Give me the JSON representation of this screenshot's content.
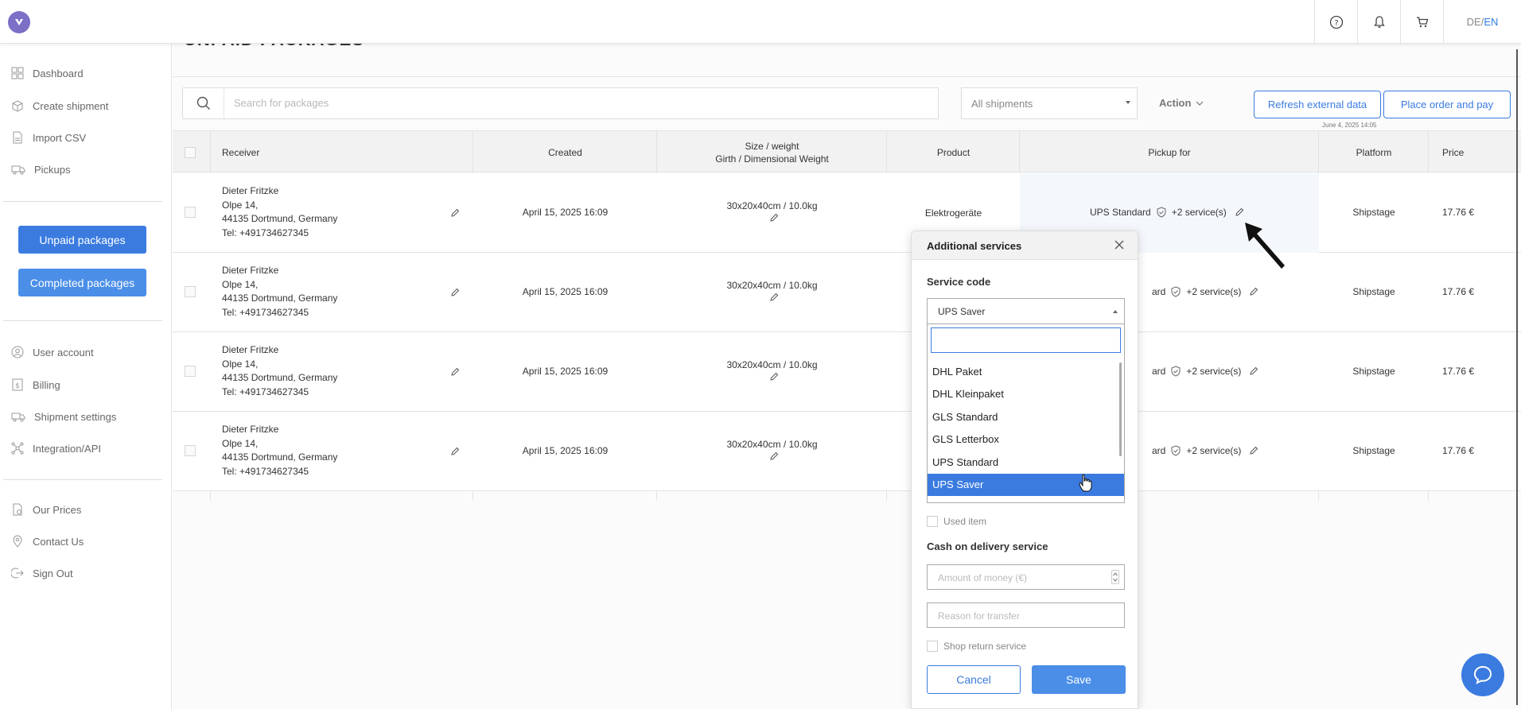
{
  "header": {
    "lang_de": "DE",
    "lang_sep": " / ",
    "lang_en": "EN"
  },
  "sidebar": {
    "items_top": [
      {
        "label": "Dashboard",
        "icon": "dashboard-icon"
      },
      {
        "label": "Create shipment",
        "icon": "box-icon"
      },
      {
        "label": "Import CSV",
        "icon": "csv-file-icon"
      },
      {
        "label": "Pickups",
        "icon": "truck-icon"
      }
    ],
    "unpaid_label": "Unpaid packages",
    "completed_label": "Completed packages",
    "items_mid": [
      {
        "label": "User account",
        "icon": "user-icon"
      },
      {
        "label": "Billing",
        "icon": "billing-icon"
      },
      {
        "label": "Shipment settings",
        "icon": "delivery-truck-icon"
      },
      {
        "label": "Integration/API",
        "icon": "integration-icon"
      }
    ],
    "items_bottom": [
      {
        "label": "Our Prices",
        "icon": "prices-icon"
      },
      {
        "label": "Contact Us",
        "icon": "location-pin-icon"
      },
      {
        "label": "Sign Out",
        "icon": "sign-out-icon"
      }
    ]
  },
  "main": {
    "page_title": "UNPAID PACKAGES",
    "search_placeholder": "Search for packages",
    "filter_value": "All shipments",
    "action_label": "Action",
    "refresh_label": "Refresh external data",
    "place_order_label": "Place order and pay",
    "refresh_timestamp": "June 4, 2025 14:05"
  },
  "table": {
    "headers": {
      "receiver": "Receiver",
      "created": "Created",
      "size_line1": "Size / weight",
      "size_line2": "Girth / Dimensional Weight",
      "product": "Product",
      "pickup": "Pickup for",
      "platform": "Platform",
      "price": "Price"
    },
    "rows": [
      {
        "name": "Dieter Fritzke",
        "street": "Olpe 14,",
        "city": "44135 Dortmund, Germany",
        "tel": "Tel: +491734627345",
        "created": "April 15, 2025 16:09",
        "size": "30x20x40cm / 10.0kg",
        "product": "Elektrogeräte",
        "pickup_service": "UPS Standard",
        "pickup_extra": "+2 service(s)",
        "platform": "Shipstage",
        "price": "17.76 €"
      },
      {
        "name": "Dieter Fritzke",
        "street": "Olpe 14,",
        "city": "44135 Dortmund, Germany",
        "tel": "Tel: +491734627345",
        "created": "April 15, 2025 16:09",
        "size": "30x20x40cm / 10.0kg",
        "product": "",
        "pickup_service": "UPS Standard",
        "pickup_extra": "+2 service(s)",
        "platform": "Shipstage",
        "price": "17.76 €"
      },
      {
        "name": "Dieter Fritzke",
        "street": "Olpe 14,",
        "city": "44135 Dortmund, Germany",
        "tel": "Tel: +491734627345",
        "created": "April 15, 2025 16:09",
        "size": "30x20x40cm / 10.0kg",
        "product": "",
        "pickup_service": "UPS Standard",
        "pickup_extra": "+2 service(s)",
        "platform": "Shipstage",
        "price": "17.76 €"
      },
      {
        "name": "Dieter Fritzke",
        "street": "Olpe 14,",
        "city": "44135 Dortmund, Germany",
        "tel": "Tel: +491734627345",
        "created": "April 15, 2025 16:09",
        "size": "30x20x40cm / 10.0kg",
        "product": "",
        "pickup_service": "UPS Standard",
        "pickup_extra": "+2 service(s)",
        "platform": "Shipstage",
        "price": "17.76 €"
      }
    ],
    "partial_pickup_text": "ard"
  },
  "modal": {
    "title": "Additional services",
    "service_code_label": "Service code",
    "selected_service": "UPS Saver",
    "options": [
      "DHL Paket",
      "DHL Kleinpaket",
      "GLS Standard",
      "GLS Letterbox",
      "UPS Standard",
      "UPS Saver"
    ],
    "selected_option_index": 5,
    "used_item_label": "Used item",
    "cod_label": "Cash on delivery service",
    "amount_placeholder": "Amount of money (€)",
    "reason_placeholder": "Reason for transfer",
    "shop_return_label": "Shop return service",
    "cancel_label": "Cancel",
    "save_label": "Save"
  },
  "colors": {
    "accent": "#3b7be0",
    "logo": "#7b6fc6"
  }
}
